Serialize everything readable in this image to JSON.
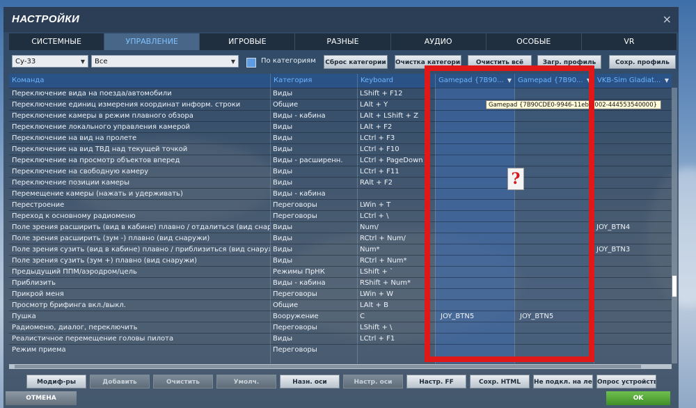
{
  "window": {
    "title": "НАСТРОЙКИ",
    "close_label": "×"
  },
  "tabs": [
    {
      "label": "СИСТЕМНЫЕ",
      "active": false
    },
    {
      "label": "УПРАВЛЕНИЕ",
      "active": true
    },
    {
      "label": "ИГРОВЫЕ",
      "active": false
    },
    {
      "label": "РАЗНЫЕ",
      "active": false
    },
    {
      "label": "АУДИО",
      "active": false
    },
    {
      "label": "ОСОБЫЕ",
      "active": false
    },
    {
      "label": "VR",
      "active": false
    }
  ],
  "toolbar": {
    "aircraft_select": "Су-33",
    "category_select": "Все",
    "by_category_label": "По категориям",
    "reset_category": "Сброс категории",
    "clear_category": "Очистка категории",
    "clear_all": "Очистить всё",
    "load_profile": "Загр. профиль",
    "save_profile": "Сохр. профиль"
  },
  "table": {
    "headers": {
      "command": "Команда",
      "category": "Категория",
      "keyboard": "Keyboard",
      "gamepad1": "Gamepad {7B90...",
      "gamepad2": "Gamepad {7B90...",
      "vkb": "VKB-Sim Gladiat..."
    },
    "rows": [
      {
        "command": "Переключение вида на поезда/автомобили",
        "category": "Виды",
        "keyboard": "LShift + F12",
        "gp1": "",
        "gp2": "",
        "vkb": ""
      },
      {
        "command": "Переключение единиц измерения координат информ. строки",
        "category": "Общие",
        "keyboard": "LAlt + Y",
        "gp1": "",
        "gp2": "",
        "vkb": ""
      },
      {
        "command": "Переключение камеры в режим плавного обзора",
        "category": "Виды - кабина",
        "keyboard": "LAlt + LShift + Z",
        "gp1": "",
        "gp2": "",
        "vkb": ""
      },
      {
        "command": "Переключение локального управления камерой",
        "category": "Виды",
        "keyboard": "LAlt + F2",
        "gp1": "",
        "gp2": "",
        "vkb": ""
      },
      {
        "command": "Переключение на вид на пролете",
        "category": "Виды",
        "keyboard": "LCtrl + F3",
        "gp1": "",
        "gp2": "",
        "vkb": ""
      },
      {
        "command": "Переключение на вид ТВД над текущей точкой",
        "category": "Виды",
        "keyboard": "LCtrl + F10",
        "gp1": "",
        "gp2": "",
        "vkb": ""
      },
      {
        "command": "Переключение на просмотр объектов вперед",
        "category": "Виды - расширенн.",
        "keyboard": "LCtrl + PageDown",
        "gp1": "",
        "gp2": "",
        "vkb": ""
      },
      {
        "command": "Переключение на свободную камеру",
        "category": "Виды",
        "keyboard": "LCtrl + F11",
        "gp1": "",
        "gp2": "",
        "vkb": ""
      },
      {
        "command": "Переключение позиции камеры",
        "category": "Виды",
        "keyboard": "RAlt + F2",
        "gp1": "",
        "gp2": "",
        "vkb": ""
      },
      {
        "command": "Перемещение камеры (нажать и удерживать)",
        "category": "Виды - кабина",
        "keyboard": "",
        "gp1": "",
        "gp2": "",
        "vkb": ""
      },
      {
        "command": "Перестроение",
        "category": "Переговоры",
        "keyboard": "LWin + T",
        "gp1": "",
        "gp2": "",
        "vkb": ""
      },
      {
        "command": "Переход к основному радиомeню",
        "category": "Переговоры",
        "keyboard": "LCtrl + \\",
        "gp1": "",
        "gp2": "",
        "vkb": ""
      },
      {
        "command": "Поле зрения расширить (вид в кабине) плавно / отдалиться (вид снаружи)",
        "category": "Виды",
        "keyboard": "Num/",
        "gp1": "",
        "gp2": "",
        "vkb": "JOY_BTN4"
      },
      {
        "command": "Поле зрения расширить (зум -) плавно (вид снаружи)",
        "category": "Виды",
        "keyboard": "RCtrl + Num/",
        "gp1": "",
        "gp2": "",
        "vkb": ""
      },
      {
        "command": "Поле зрения сузить (вид в кабине) плавно / приблизиться (вид снаружи)",
        "category": "Виды",
        "keyboard": "Num*",
        "gp1": "",
        "gp2": "",
        "vkb": "JOY_BTN3"
      },
      {
        "command": "Поле зрения сузить (зум +) плавно (вид снаружи)",
        "category": "Виды",
        "keyboard": "RCtrl + Num*",
        "gp1": "",
        "gp2": "",
        "vkb": ""
      },
      {
        "command": "Предыдущий ППМ/аэродром/цель",
        "category": "Режимы ПрНК",
        "keyboard": "LShift + `",
        "gp1": "",
        "gp2": "",
        "vkb": ""
      },
      {
        "command": "Приблизить",
        "category": "Виды - кабина",
        "keyboard": "RShift + Num*",
        "gp1": "",
        "gp2": "",
        "vkb": ""
      },
      {
        "command": "Прикрой меня",
        "category": "Переговоры",
        "keyboard": "LWin + W",
        "gp1": "",
        "gp2": "",
        "vkb": ""
      },
      {
        "command": "Просмотр брифинга вкл./выкл.",
        "category": "Общие",
        "keyboard": "LAlt + B",
        "gp1": "",
        "gp2": "",
        "vkb": ""
      },
      {
        "command": "Пушка",
        "category": "Вооружение",
        "keyboard": "C",
        "gp1": "JOY_BTN5",
        "gp2": "JOY_BTN5",
        "vkb": ""
      },
      {
        "command": "Радиоменю, диалог, переключить",
        "category": "Переговоры",
        "keyboard": "LShift + \\",
        "gp1": "",
        "gp2": "",
        "vkb": ""
      },
      {
        "command": "Реалистичное перемещение головы пилота",
        "category": "Виды",
        "keyboard": "LCtrl + F1",
        "gp1": "",
        "gp2": "",
        "vkb": ""
      },
      {
        "command": "Режим приема",
        "category": "Переговоры",
        "keyboard": "",
        "gp1": "",
        "gp2": "",
        "vkb": ""
      }
    ]
  },
  "tooltip": "Gamepad {7B90CDE0-9946-11eb-8002-444553540000}",
  "missing_icon": "?",
  "bottom_buttons": {
    "modifiers": "Модиф-ры",
    "add": "Добавить",
    "clear": "Очистить",
    "default": "Умолч.",
    "assign_axis": "Назн. оси",
    "axis_tune": "Настр. оси",
    "ff_tune": "Настр. FF",
    "save_html": "Сохр. HTML",
    "no_hotplug": "Не подкл. на лету",
    "poll_devices": "Опрос устройств"
  },
  "footer": {
    "cancel": "ОТМЕНА",
    "ok": "OK"
  }
}
